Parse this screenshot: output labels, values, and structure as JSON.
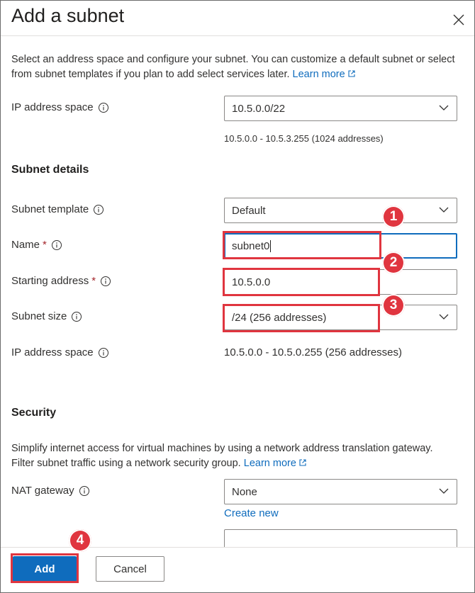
{
  "dialog": {
    "title": "Add a subnet",
    "description": "Select an address space and configure your subnet. You can customize a default subnet or select from subnet templates if you plan to add select services later.",
    "learn_more": "Learn more"
  },
  "address_space": {
    "label": "IP address space",
    "value": "10.5.0.0/22",
    "range_hint": "10.5.0.0 - 10.5.3.255 (1024 addresses)"
  },
  "subnet_details": {
    "heading": "Subnet details",
    "template_label": "Subnet template",
    "template_value": "Default",
    "name_label": "Name",
    "name_value": "subnet0",
    "start_label": "Starting address",
    "start_value": "10.5.0.0",
    "size_label": "Subnet size",
    "size_value": "/24 (256 addresses)",
    "ip_space_label": "IP address space",
    "ip_space_value": "10.5.0.0 - 10.5.0.255 (256 addresses)",
    "required_mark": "*"
  },
  "security": {
    "heading": "Security",
    "description": "Simplify internet access for virtual machines by using a network address translation gateway. Filter subnet traffic using a network security group.",
    "learn_more": "Learn more",
    "nat_label": "NAT gateway",
    "nat_value": "None",
    "create_new": "Create new"
  },
  "footer": {
    "add_label": "Add",
    "cancel_label": "Cancel"
  },
  "annotations": [
    "1",
    "2",
    "3",
    "4"
  ],
  "colors": {
    "accent": "#0f6cbd",
    "highlight": "#e0353f"
  }
}
